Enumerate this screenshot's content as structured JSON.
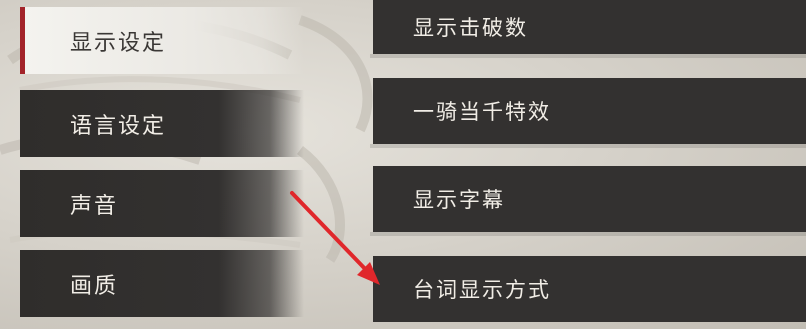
{
  "left_menu": {
    "items": [
      {
        "label": "显示设定",
        "selected": true
      },
      {
        "label": "语言设定",
        "selected": false
      },
      {
        "label": "声音",
        "selected": false
      },
      {
        "label": "画质",
        "selected": false
      }
    ]
  },
  "right_menu": {
    "items": [
      {
        "label": "显示击破数"
      },
      {
        "label": "一骑当千特效"
      },
      {
        "label": "显示字幕"
      },
      {
        "label": "台词显示方式"
      }
    ]
  },
  "colors": {
    "accent": "#a3242a",
    "panel": "#333130",
    "selected_panel": "#f4f3ef",
    "annotation_arrow": "#e0272b"
  }
}
